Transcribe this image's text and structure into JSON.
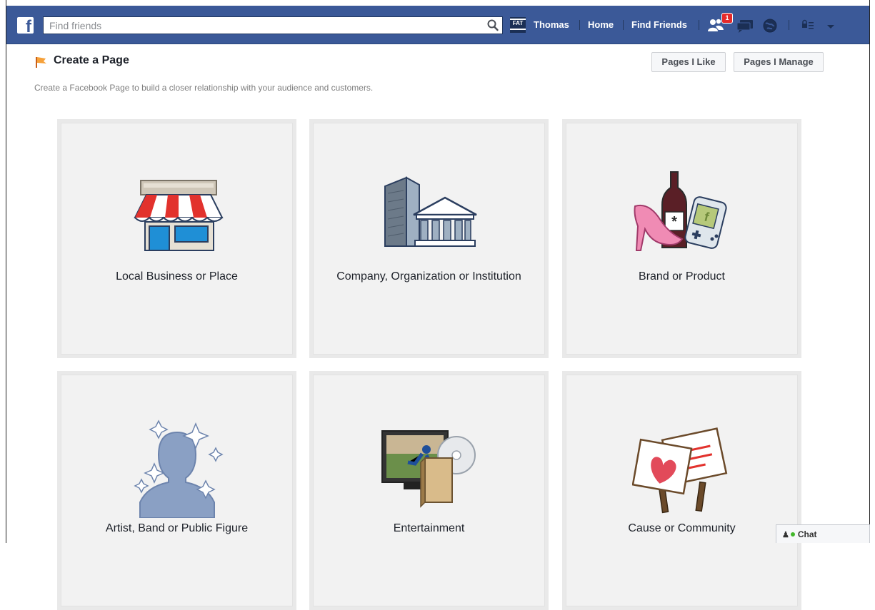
{
  "topbar": {
    "logo": "f",
    "search_placeholder": "Find friends",
    "avatar_text": "FAT",
    "user_name": "Thomas",
    "home": "Home",
    "find_friends": "Find Friends",
    "friend_requests_count": "1",
    "icons": [
      "facebook-logo-icon",
      "search-icon",
      "friend-requests-icon",
      "messages-icon",
      "notifications-globe-icon",
      "privacy-shortcuts-icon",
      "account-menu-chevron-icon"
    ],
    "brand_color": "#3b5998"
  },
  "header": {
    "title": "Create a Page",
    "subtitle": "Create a Facebook Page to build a closer relationship with your audience and customers.",
    "pages_i_like": "Pages I Like",
    "pages_i_manage": "Pages I Manage"
  },
  "categories": [
    {
      "label": "Local Business or Place",
      "icon": "storefront-icon"
    },
    {
      "label": "Company, Organization or Institution",
      "icon": "company-buildings-icon"
    },
    {
      "label": "Brand or Product",
      "icon": "brand-products-icon"
    },
    {
      "label": "Artist, Band or Public Figure",
      "icon": "public-figure-silhouette-icon"
    },
    {
      "label": "Entertainment",
      "icon": "entertainment-media-icon"
    },
    {
      "label": "Cause or Community",
      "icon": "cause-signs-icon"
    }
  ],
  "chat": {
    "label": "Chat",
    "status_color": "#42b72a"
  }
}
